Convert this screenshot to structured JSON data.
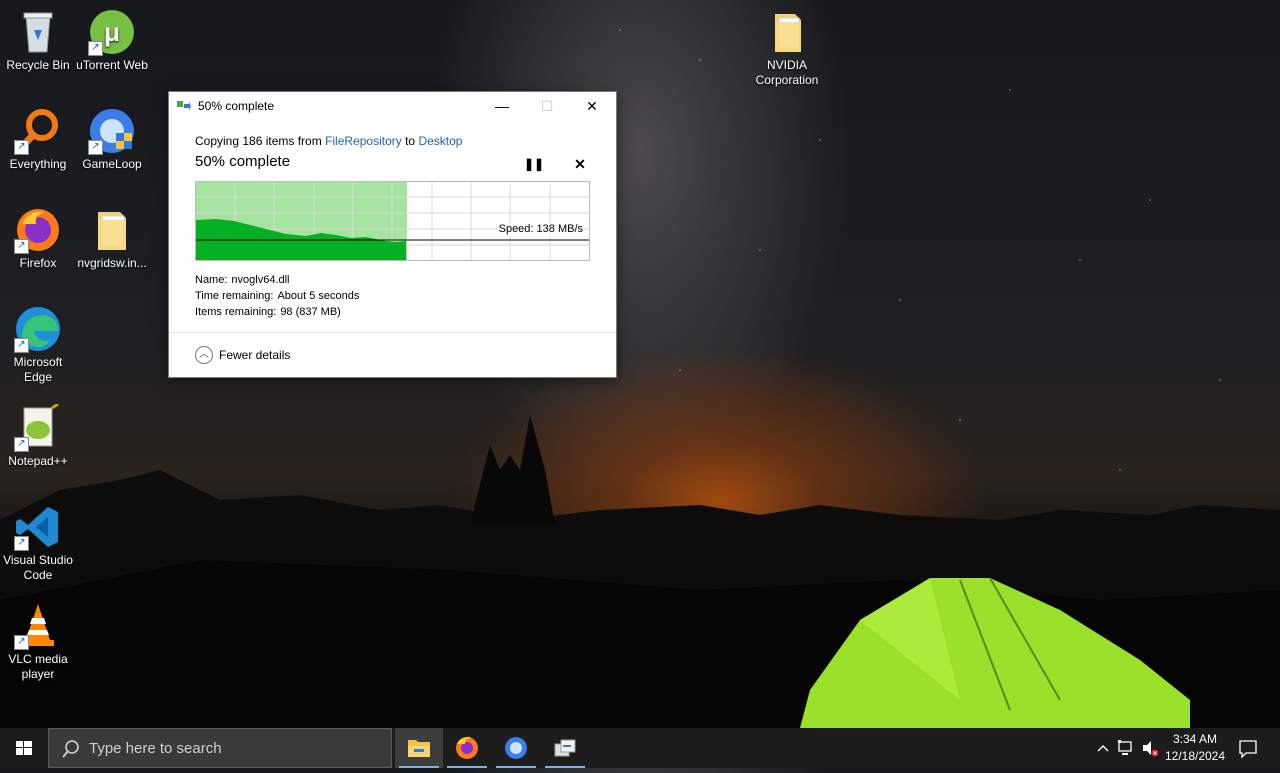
{
  "desktop": {
    "icons": [
      {
        "label": "Recycle Bin",
        "icon": "recycle-bin-icon"
      },
      {
        "label": "uTorrent Web",
        "icon": "utorrent-icon"
      },
      {
        "label": "Everything",
        "icon": "everything-search-icon"
      },
      {
        "label": "GameLoop",
        "icon": "gameloop-icon"
      },
      {
        "label": "Firefox",
        "icon": "firefox-icon"
      },
      {
        "label": "nvgridsw.in...",
        "icon": "folder-icon"
      },
      {
        "label": "Microsoft Edge",
        "icon": "edge-icon"
      },
      {
        "label": "Notepad++",
        "icon": "notepadpp-icon"
      },
      {
        "label": "Visual Studio Code",
        "icon": "vscode-icon"
      },
      {
        "label": "VLC media player",
        "icon": "vlc-icon"
      },
      {
        "label": "NVIDIA Corporation",
        "icon": "folder-icon"
      }
    ]
  },
  "dialog": {
    "title": "50% complete",
    "copy_prefix": "Copying 186 items from ",
    "source": "FileRepository",
    "to_word": " to ",
    "destination": "Desktop",
    "status": "50% complete",
    "progress_fraction": 0.5,
    "speed": "Speed: 138 MB/s",
    "name_label": "Name:",
    "name_value": "nvoglv64.dll",
    "time_label": "Time remaining:",
    "time_value": "About 5 seconds",
    "items_label": "Items remaining:",
    "items_value": "98 (837 MB)",
    "fewer_details": "Fewer details"
  },
  "taskbar": {
    "search_placeholder": "Type here to search",
    "apps": [
      "file-explorer-icon",
      "firefox-icon",
      "gameloop-icon",
      "file-copy-icon"
    ],
    "time": "3:34 AM",
    "date": "12/18/2024"
  },
  "colors": {
    "progress_fill": "#a6e3a1",
    "graph_fill": "#06b025",
    "link": "#1e64b4",
    "taskbar": "#1c1c1c"
  }
}
